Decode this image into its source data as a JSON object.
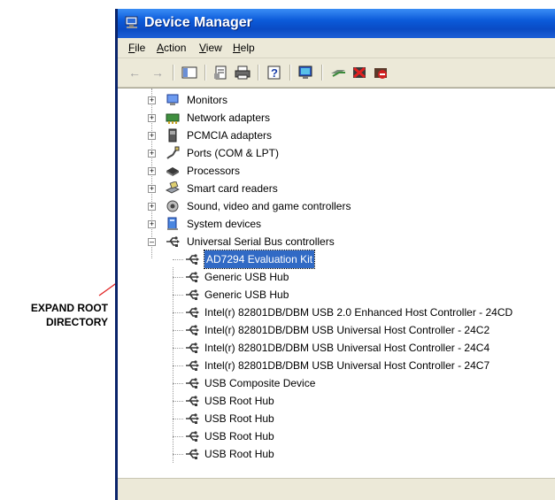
{
  "annotation": {
    "line1": "EXPAND ROOT",
    "line2": "DIRECTORY"
  },
  "window": {
    "title": "Device Manager"
  },
  "menu": [
    "File",
    "Action",
    "View",
    "Help"
  ],
  "toolbar": {
    "buttons": [
      "back-icon",
      "forward-icon",
      "show-hide-console-tree-icon",
      "properties-icon",
      "print-icon",
      "help-icon",
      "scan-hardware-icon",
      "update-driver-icon",
      "uninstall-icon",
      "disable-icon"
    ]
  },
  "tree": {
    "categories": [
      "Monitors",
      "Network adapters",
      "PCMCIA adapters",
      "Ports (COM & LPT)",
      "Processors",
      "Smart card readers",
      "Sound, video and game controllers",
      "System devices",
      "Universal Serial Bus controllers"
    ],
    "usb_devices": [
      "AD7294 Evaluation Kit",
      "Generic USB Hub",
      "Generic USB Hub",
      "Intel(r) 82801DB/DBM USB 2.0 Enhanced Host Controller - 24CD",
      "Intel(r) 82801DB/DBM USB Universal Host Controller - 24C2",
      "Intel(r) 82801DB/DBM USB Universal Host Controller - 24C4",
      "Intel(r) 82801DB/DBM USB Universal Host Controller - 24C7",
      "USB Composite Device",
      "USB Root Hub",
      "USB Root Hub",
      "USB Root Hub",
      "USB Root Hub"
    ],
    "selected": "AD7294 Evaluation Kit"
  },
  "colors": {
    "titlebar": "#0a4bc4",
    "selection": "#316ac5",
    "arrow": "#e02020",
    "chrome": "#ece9d8"
  }
}
